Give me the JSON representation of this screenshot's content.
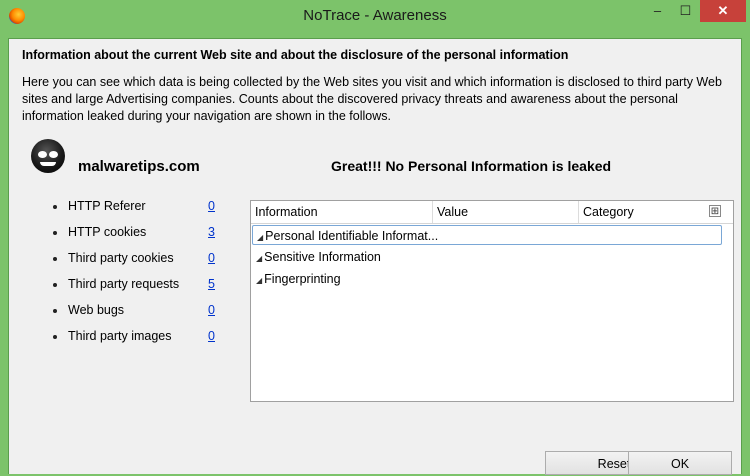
{
  "window": {
    "title": "NoTrace - Awareness",
    "min_glyph": "–",
    "max_glyph": "☐",
    "close_glyph": "✕"
  },
  "heading": "Information about the current Web site and about the disclosure of the personal information",
  "description": "Here you can see which data is being collected by the Web sites you visit and which information is disclosed to third party Web sites and large Advertising companies. Counts about the discovered privacy threats and awareness about the personal information leaked during your navigation are shown in the follows.",
  "site": "malwaretips.com",
  "status": "Great!!! No Personal Information is leaked",
  "stats": [
    {
      "label": "HTTP Referer",
      "count": "0"
    },
    {
      "label": "HTTP cookies",
      "count": "3"
    },
    {
      "label": "Third party cookies",
      "count": "0"
    },
    {
      "label": "Third party requests",
      "count": "5"
    },
    {
      "label": "Web bugs",
      "count": "0"
    },
    {
      "label": "Third party images",
      "count": "0"
    }
  ],
  "tree": {
    "columns": [
      "Information",
      "Value",
      "Category"
    ],
    "col_picker_glyph": "⊞",
    "rows": [
      "Personal Identifiable Informat...",
      "Sensitive Information",
      "Fingerprinting"
    ],
    "twisty": "◢"
  },
  "buttons": {
    "reset": "Reset",
    "ok": "OK"
  },
  "colors": {
    "frame": "#7cc36a",
    "close": "#c7413a",
    "link": "#0033cc"
  }
}
